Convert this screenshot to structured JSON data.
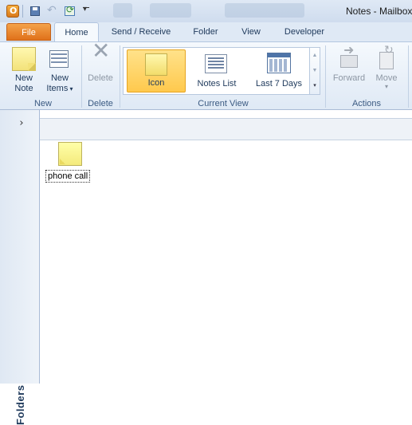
{
  "window": {
    "title": "Notes - Mailbox"
  },
  "qat": {
    "app_icon": "outlook-logo-icon",
    "save_icon": "save-icon",
    "undo_icon": "undo-icon",
    "send_receive_icon": "send-receive-icon",
    "customize_icon": "customize-qat-icon"
  },
  "tabs": [
    {
      "label": "File",
      "active": false
    },
    {
      "label": "Home",
      "active": true
    },
    {
      "label": "Send / Receive",
      "active": false
    },
    {
      "label": "Folder",
      "active": false
    },
    {
      "label": "View",
      "active": false
    },
    {
      "label": "Developer",
      "active": false
    }
  ],
  "ribbon": {
    "new_group": {
      "label": "New",
      "new_note": {
        "line1": "New",
        "line2": "Note"
      },
      "new_items": {
        "line1": "New",
        "line2": "Items"
      }
    },
    "delete_group": {
      "label": "Delete",
      "delete": "Delete"
    },
    "current_view_group": {
      "label": "Current View",
      "items": [
        "Icon",
        "Notes List",
        "Last 7 Days"
      ],
      "selected": "Icon"
    },
    "actions_group": {
      "label": "Actions",
      "forward": "Forward",
      "move": "Move"
    }
  },
  "folder_pane": {
    "label": "Folders"
  },
  "notes": [
    {
      "title": "phone call"
    }
  ],
  "colors": {
    "accent_file": "#e0711a",
    "selected_view": "#ffc94d",
    "note_yellow": "#fff8b0"
  }
}
